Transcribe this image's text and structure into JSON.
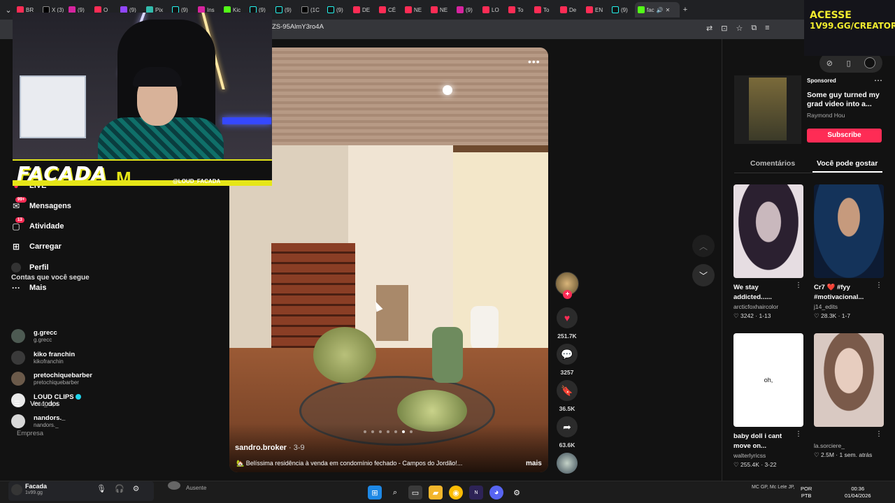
{
  "browser": {
    "tabs": [
      "BR",
      "X (3)",
      "(9)",
      "O",
      "(9)",
      "Pix",
      "(9)",
      "Ins",
      "Kic",
      "(9)",
      "(9)",
      "(1C",
      "(9)",
      "DE",
      "CÉ",
      "NE",
      "NE",
      "(9)",
      "LO",
      "To",
      "To",
      "De",
      "EN",
      "(9)",
      "fac"
    ],
    "url": "ZS-95AlmY3ro4A"
  },
  "stream": {
    "logo": "FACADA",
    "handle": "@LOUD_FACADA",
    "ad_line1": "ACESSE",
    "ad_line2": "1V99.GG/CREATORS"
  },
  "sidebar": {
    "items": [
      {
        "label": "LIVE",
        "icon": "live-icon"
      },
      {
        "label": "Mensagens",
        "icon": "messages-icon",
        "badge": "99+"
      },
      {
        "label": "Atividade",
        "icon": "activity-icon",
        "badge": "13"
      },
      {
        "label": "Carregar",
        "icon": "upload-icon"
      },
      {
        "label": "Perfil",
        "icon": "profile-icon"
      },
      {
        "label": "Mais",
        "icon": "more-icon"
      }
    ],
    "following_title": "Contas que você segue",
    "accounts": [
      {
        "name": "g.grecc",
        "handle": "g.grecc"
      },
      {
        "name": "kiko franchin",
        "handle": "kikofranchin"
      },
      {
        "name": "pretochiquebarber",
        "handle": "pretochiquebarber"
      },
      {
        "name": "LOUD CLIPS",
        "handle": "loud_clips"
      },
      {
        "name": "nandors._",
        "handle": "nandors._"
      }
    ],
    "see_all": "Ver todos",
    "company": "Empresa"
  },
  "video": {
    "author": "sandro.broker",
    "date": "· 3-9",
    "caption": "🏡 Belíssima residência à venda em condomínio fechado - Campos do Jordão!...",
    "more": "mais",
    "likes": "251.7K",
    "comments": "3257",
    "saves": "36.5K",
    "shares": "63.6K"
  },
  "right_panel": {
    "sponsored": "Sponsored",
    "ad_title": "Some guy turned my grad video into a...",
    "ad_author": "Raymond Hou",
    "subscribe": "Subscribe",
    "tabs": [
      "Comentários",
      "Você pode gostar"
    ],
    "cards": [
      {
        "title": "We stay addicted......",
        "author": "arcticfoxhaircolor",
        "likes": "3242",
        "date": "1-13"
      },
      {
        "title": "Cr7 ❤️ #fyy #motivacional...",
        "author": "j14_edits",
        "likes": "28.3K",
        "date": "1-7"
      },
      {
        "title": "baby doll i cant move on...",
        "author": "walterlyricss",
        "likes": "255.4K",
        "date": "3-22",
        "thumb_text": "oh,"
      },
      {
        "title": "",
        "author": "la.sorciere_",
        "likes": "2.5M",
        "date": "1 sem. atrás"
      }
    ]
  },
  "taskbar": {
    "discord_name": "Facada",
    "discord_handle": "1v99.gg",
    "dm_status": "Ausente",
    "news": "MC GP, Mc Lele JP, DJ ...",
    "lang1": "POR",
    "lang2": "PTB",
    "time": "00:36",
    "date": "01/04/2026"
  },
  "colors": {
    "accent": "#fe2c55",
    "background": "#121212",
    "stream_yellow": "#e6e617"
  }
}
